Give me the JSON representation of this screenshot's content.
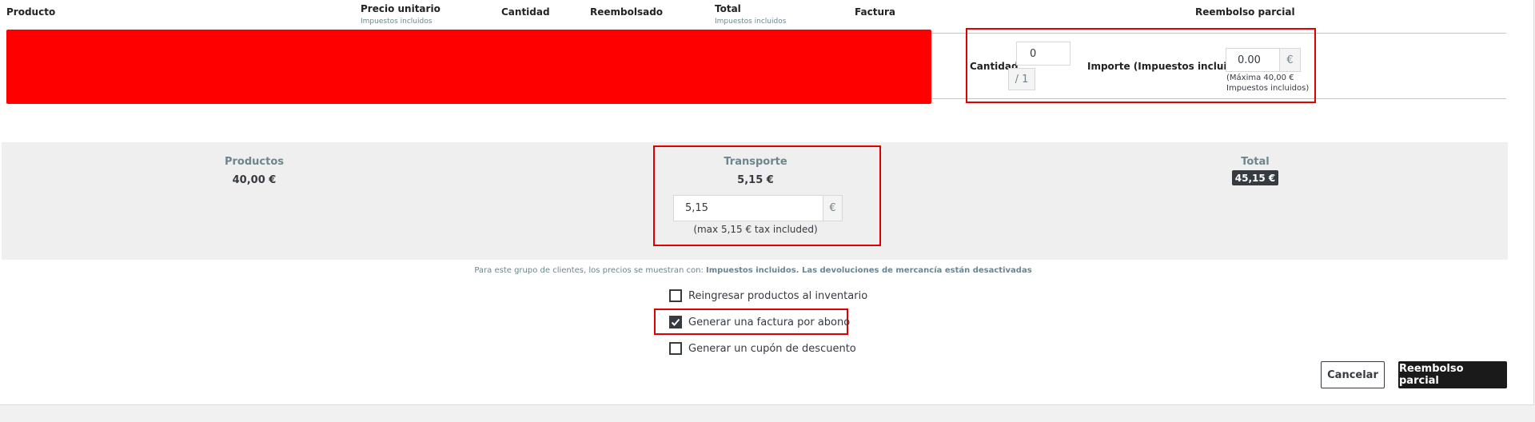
{
  "table": {
    "headers": {
      "product": "Producto",
      "unit_price": "Precio unitario",
      "unit_price_sub": "Impuestos incluidos",
      "quantity": "Cantidad",
      "refunded": "Reembolsado",
      "total": "Total",
      "total_sub": "Impuestos incluidos",
      "invoice": "Factura",
      "partial_refund": "Reembolso parcial"
    }
  },
  "refund_row": {
    "quantity_label": "Cantidad",
    "quantity_value": "0",
    "quantity_max": "/ 1",
    "amount_label": "Importe (Impuestos incluidos)",
    "amount_value": "0.00",
    "amount_currency": "€",
    "amount_hint_line1": "(Máxima 40,00 €",
    "amount_hint_line2": "Impuestos incluidos)"
  },
  "summary": {
    "products_label": "Productos",
    "products_value": "40,00 €",
    "shipping_label": "Transporte",
    "shipping_value": "5,15 €",
    "shipping_input": "5,15",
    "shipping_currency": "€",
    "shipping_hint": "(max 5,15 € tax included)",
    "total_label": "Total",
    "total_value": "45,15 €"
  },
  "note": {
    "prefix": "Para este grupo de clientes, los precios se muestran con: ",
    "bold1": "Impuestos incluidos",
    "middle": ". ",
    "bold2": "Las devoluciones de mercancía están desactivadas"
  },
  "options": [
    {
      "label": "Reingresar productos al inventario",
      "checked": false
    },
    {
      "label": "Generar una factura por abono",
      "checked": true
    },
    {
      "label": "Generar un cupón de descuento",
      "checked": false
    }
  ],
  "buttons": {
    "cancel": "Cancelar",
    "submit": "Reembolso parcial"
  },
  "colors": {
    "highlight_box": "#e00000",
    "redaction": "#ff0000",
    "primary_dark": "#1a1a1a"
  }
}
